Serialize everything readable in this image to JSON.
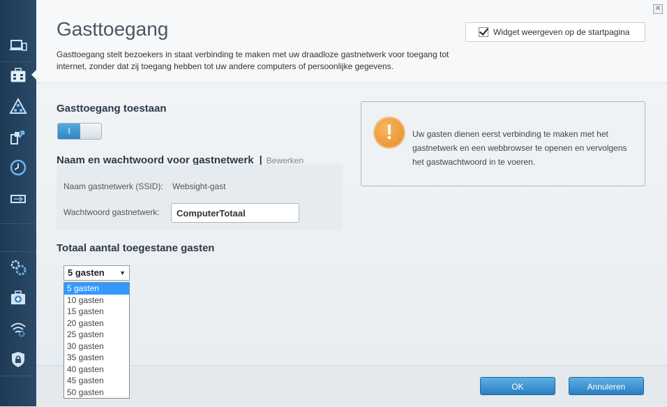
{
  "header": {
    "title": "Gasttoegang",
    "description": "Gasttoegang stelt bezoekers in staat verbinding te maken met uw draadloze gastnetwerk voor toegang tot internet, zonder dat zij toegang hebben tot uw andere computers of persoonlijke gegevens.",
    "widget_label": "Widget weergeven op de startpagina",
    "widget_checked": true,
    "close_glyph": "✕"
  },
  "sidebar": {
    "items": [
      {
        "icon": "devices-icon"
      },
      {
        "icon": "toolbox-icon",
        "active": true
      },
      {
        "icon": "network-map-icon"
      },
      {
        "icon": "priority-icon"
      },
      {
        "icon": "clock-icon"
      },
      {
        "icon": "usb-icon"
      },
      {
        "icon": "settings-gears-icon"
      },
      {
        "icon": "troubleshooting-icon"
      },
      {
        "icon": "wifi-icon"
      },
      {
        "icon": "security-icon"
      }
    ]
  },
  "guest_access": {
    "allow_heading": "Gasttoegang toestaan",
    "toggle_on_label": "I",
    "toggle_on": true,
    "name_heading": "Naam en wachtwoord voor gastnetwerk",
    "separator": "|",
    "edit_link": "Bewerken",
    "ssid_label": "Naam gastnetwerk (SSID):",
    "ssid_value": "Websight-gast",
    "password_label": "Wachtwoord gastnetwerk:",
    "password_value": "ComputerTotaal",
    "total_heading": "Totaal aantal toegestane gasten",
    "selected_guests": "5 gasten",
    "options": [
      "5 gasten",
      "10 gasten",
      "15 gasten",
      "20 gasten",
      "25 gasten",
      "30 gasten",
      "35 gasten",
      "40 gasten",
      "45 gasten",
      "50 gasten"
    ]
  },
  "info": {
    "icon_glyph": "!",
    "text": "Uw gasten dienen eerst verbinding te maken met het gastnetwerk en een webbrowser te openen en vervolgens het gastwachtwoord in te voeren."
  },
  "footer": {
    "ok_label": "OK",
    "cancel_label": "Annuleren"
  },
  "colors": {
    "sidebar": "#1e3a55",
    "accent": "#2f85c5",
    "warning": "#e58a22",
    "selection": "#3399ff"
  }
}
